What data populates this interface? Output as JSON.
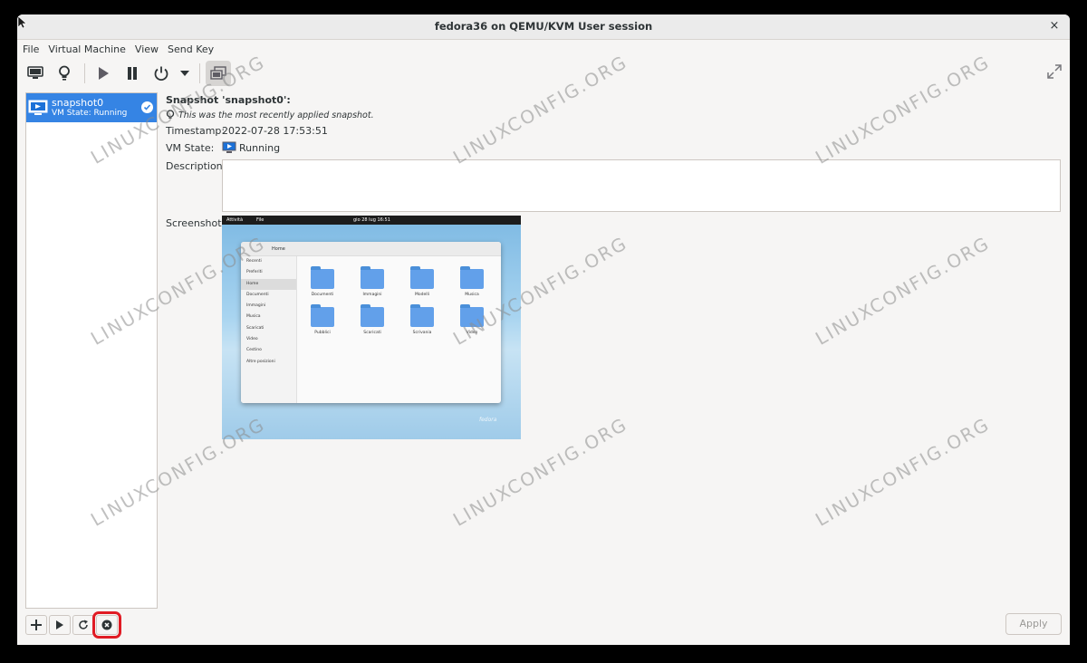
{
  "window": {
    "title": "fedora36 on QEMU/KVM User session",
    "close_glyph": "×"
  },
  "menu": [
    "File",
    "Virtual Machine",
    "View",
    "Send Key"
  ],
  "toolbar": {
    "icons": [
      "monitor-icon",
      "lightbulb-icon",
      "play-icon",
      "pause-icon",
      "power-icon",
      "dropdown-arrow-icon",
      "snapshots-icon",
      "fullscreen-icon"
    ]
  },
  "snapshot_list": [
    {
      "name": "snapshot0",
      "state": "VM State: Running",
      "current": true
    }
  ],
  "details": {
    "heading": "Snapshot 'snapshot0':",
    "hint": "This was the most recently applied snapshot.",
    "timestamp_label": "Timestamp:",
    "timestamp": "2022-07-28 17:53:51",
    "vmstate_label": "VM State:",
    "vmstate": "Running",
    "description_label": "Description:",
    "description": "",
    "screenshot_label": "Screenshot:"
  },
  "screenshot_preview": {
    "topbar_left": "Attività",
    "topbar_app": "File",
    "topbar_clock": "gio 28 lug 16:51",
    "location": "Home",
    "sidebar": [
      "Recenti",
      "Preferiti",
      "Home",
      "Documenti",
      "Immagini",
      "Musica",
      "Scaricati",
      "Video",
      "Cestino",
      "Altre posizioni"
    ],
    "folders": [
      "Documenti",
      "Immagini",
      "Modelli",
      "Musica",
      "Pubblici",
      "Scaricati",
      "Scrivania",
      "Video"
    ],
    "brand": "fedora"
  },
  "bottom": {
    "apply_label": "Apply"
  },
  "watermark": "LINUXCONFIG.ORG",
  "colors": {
    "accent": "#3584e4",
    "highlight": "#e01b24"
  }
}
